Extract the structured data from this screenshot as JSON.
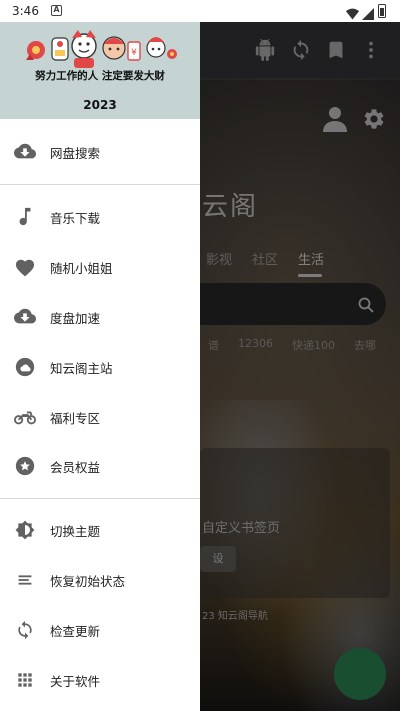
{
  "status_bar": {
    "time": "3:46",
    "notification_letter": "A"
  },
  "drawer": {
    "banner": {
      "slogan": "努力工作的人 注定要发大财",
      "year": "2023"
    },
    "items": [
      {
        "label": "网盘搜索",
        "icon": "cloud-download-icon"
      },
      {
        "label": "音乐下载",
        "icon": "music-note-icon"
      },
      {
        "label": "随机小姐姐",
        "icon": "heart-icon"
      },
      {
        "label": "度盘加速",
        "icon": "cloud-download-icon"
      },
      {
        "label": "知云阁主站",
        "icon": "cloud-icon"
      },
      {
        "label": "福利专区",
        "icon": "motorcycle-icon"
      },
      {
        "label": "会员权益",
        "icon": "star-circle-icon"
      },
      {
        "label": "切换主题",
        "icon": "brightness-icon"
      },
      {
        "label": "恢复初始状态",
        "icon": "sort-lines-icon"
      },
      {
        "label": "检查更新",
        "icon": "refresh-icon"
      },
      {
        "label": "关于软件",
        "icon": "grid-apps-icon"
      }
    ]
  },
  "background": {
    "title_partial": "云阁",
    "tabs": [
      {
        "label": "影视"
      },
      {
        "label": "社区"
      },
      {
        "label": "生活"
      }
    ],
    "active_tab": "生活",
    "quick_links": [
      "谱",
      "12306",
      "快递100",
      "去哪"
    ],
    "card_text": "自定义书签页",
    "card_button": "设",
    "footer": "23 知云阁导航"
  },
  "colors": {
    "drawer_header_bg": "#c5d3d2",
    "icon_gray": "#616161",
    "fab_green": "#2f8f59"
  }
}
